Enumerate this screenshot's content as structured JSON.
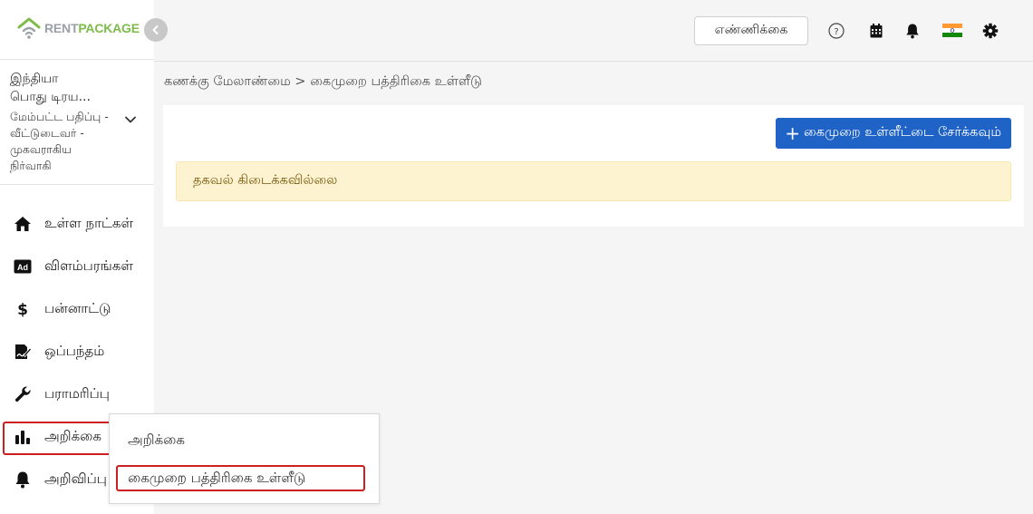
{
  "logo": {
    "rent": "RENT",
    "package": "PACKAGE"
  },
  "account": {
    "country": "இந்தியா",
    "title": "பொது டிரய...",
    "role": "மேம்பட்ட பதிப்பு - வீட்டுடைவர் - முகவராகிய நிர்வாகி"
  },
  "sidebar": {
    "items": [
      {
        "label": "உள்ள நாட்கள்",
        "icon": "home-icon"
      },
      {
        "label": "விளம்பரங்கள்",
        "icon": "ad-icon"
      },
      {
        "label": "பன்னாட்டு",
        "icon": "dollar-icon"
      },
      {
        "label": "ஒப்பந்தம்",
        "icon": "contract-icon"
      },
      {
        "label": "பராமரிப்பு",
        "icon": "wrench-icon"
      },
      {
        "label": "அறிக்கை",
        "icon": "bar-chart-icon"
      },
      {
        "label": "அறிவிப்பு",
        "icon": "bell-icon"
      }
    ]
  },
  "topbar": {
    "count_button": "எண்ணிக்கை",
    "icons": [
      "help-icon",
      "calendar-icon",
      "notification-bell-icon",
      "india-flag-icon",
      "settings-gear-icon"
    ]
  },
  "breadcrumb": "கணக்கு மேலாண்மை > கைமுறை பத்திரிகை உள்ளீடு",
  "main": {
    "add_button": "கைமுறை உள்ளீட்டை சேர்க்கவும்",
    "add_button_plus": "+",
    "alert": "தகவல் கிடைக்கவில்லை"
  },
  "dropdown": {
    "items": [
      "அறிக்கை",
      "கைமுறை பத்திரிகை உள்ளீடு"
    ]
  },
  "colors": {
    "primary": "#1f63c6",
    "alert_bg": "#fdf3d0",
    "highlight_border": "#cc1f1f",
    "logo_green": "#7dbb4a"
  }
}
